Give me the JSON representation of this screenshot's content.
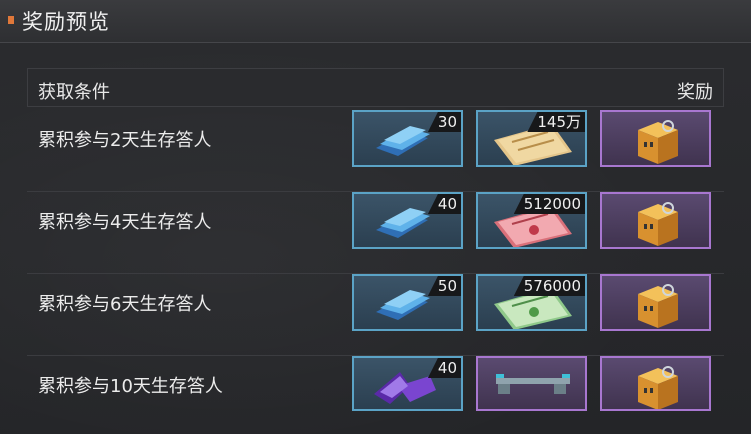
{
  "title": "奖励预览",
  "header": {
    "condition_label": "获取条件",
    "reward_label": "奖励"
  },
  "rows": [
    {
      "condition": "累积参与2天生存答人",
      "rewards": [
        {
          "icon": "blue-book-icon",
          "qty": "30",
          "quality": "blue"
        },
        {
          "icon": "yellow-ticket-icon",
          "qty": "145万",
          "quality": "blue"
        },
        {
          "icon": "gold-box-icon",
          "qty": "",
          "quality": "purple"
        }
      ]
    },
    {
      "condition": "累积参与4天生存答人",
      "rewards": [
        {
          "icon": "blue-book-icon",
          "qty": "40",
          "quality": "blue"
        },
        {
          "icon": "red-ticket-icon",
          "qty": "512000",
          "quality": "blue"
        },
        {
          "icon": "gold-box-icon",
          "qty": "",
          "quality": "purple"
        }
      ]
    },
    {
      "condition": "累积参与6天生存答人",
      "rewards": [
        {
          "icon": "blue-book-icon",
          "qty": "50",
          "quality": "blue"
        },
        {
          "icon": "green-ticket-icon",
          "qty": "576000",
          "quality": "blue"
        },
        {
          "icon": "gold-box-icon",
          "qty": "",
          "quality": "purple"
        }
      ]
    },
    {
      "condition": "累积参与10天生存答人",
      "rewards": [
        {
          "icon": "purple-book-icon",
          "qty": "40",
          "quality": "blue"
        },
        {
          "icon": "weapon-part-icon",
          "qty": "",
          "quality": "purple"
        },
        {
          "icon": "gold-box-icon",
          "qty": "",
          "quality": "purple"
        }
      ]
    }
  ],
  "colors": {
    "accent": "#e0783a",
    "blue_quality": "#5ba3c6",
    "purple_quality": "#a877d0"
  }
}
